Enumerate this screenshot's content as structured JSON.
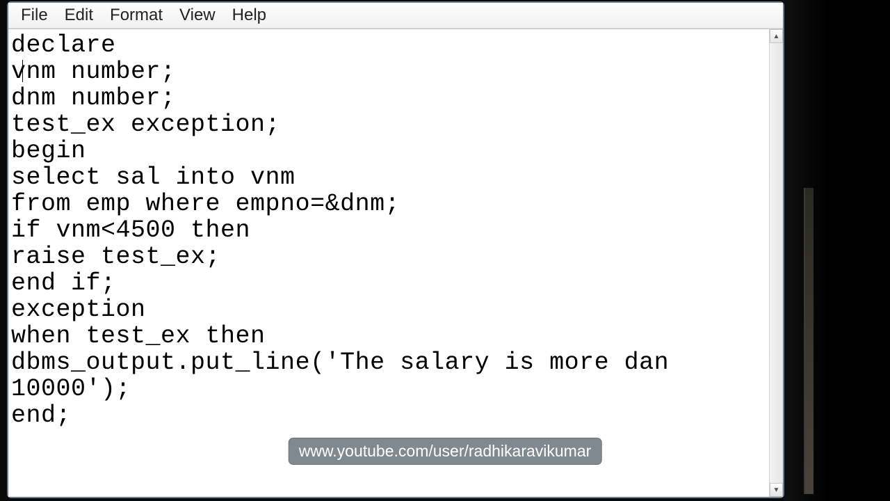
{
  "menu": {
    "file": "File",
    "edit": "Edit",
    "format": "Format",
    "view": "View",
    "help": "Help"
  },
  "editor": {
    "content": "declare\nvnm number;\ndnm number;\ntest_ex exception;\nbegin\nselect sal into vnm\nfrom emp where empno=&dnm;\nif vnm<4500 then\nraise test_ex;\nend if;\nexception\nwhen test_ex then\ndbms_output.put_line('The salary is more dan 10000');\nend;"
  },
  "scroll": {
    "up_glyph": "▲",
    "down_glyph": "▼"
  },
  "overlay": {
    "url_text": "www.youtube.com/user/radhikaravikumar"
  }
}
